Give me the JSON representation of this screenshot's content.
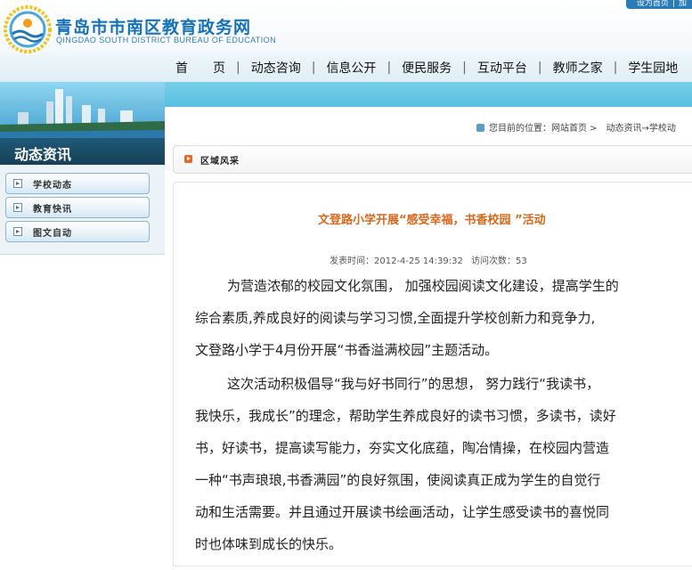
{
  "header": {
    "title": "青岛市市南区教育政务网",
    "subtitle": "QINGDAO SOUTH DISTRICT BUREAU OF EDUCATION",
    "top_links": [
      "设为首页",
      "|",
      "加"
    ]
  },
  "nav": [
    "首　　页",
    "动态咨询",
    "信息公开",
    "便民服务",
    "互动平台",
    "教师之家",
    "学生园地"
  ],
  "sidebar": {
    "title": "动态资讯",
    "items": [
      "学校动态",
      "教育快讯",
      "图文自动"
    ]
  },
  "breadcrumb": "您目前的位置：网站首页 >　动态资讯→学校动",
  "section_label": "区域风采",
  "article": {
    "title": "文登路小学开展“感受幸福，书香校园 ”活动",
    "publish_label": "发表时间：2012-4-25 14:39:32",
    "views_label": "访问次数：53",
    "lines": [
      "为营造浓郁的校园文化氛围， 加强校园阅读文化建设，提高学生的",
      "综合素质,养成良好的阅读与学习习惯,全面提升学校创新力和竞争力,",
      "文登路小学于4月份开展“书香溢满校园”主题活动。",
      "这次活动积极倡导“我与好书同行”的思想， 努力践行“我读书，",
      "我快乐，我成长”的理念，帮助学生养成良好的读书习惯，多读书，读好",
      "书，好读书，提高读写能力，夯实文化底蕴，陶冶情操，在校园内营造",
      "一种“书声琅琅,书香满园”的良好氛围，使阅读真正成为学生的自觉行",
      "动和生活需要。并且通过开展读书绘画活动，让学生感受读书的喜悦同",
      "时也体味到成长的快乐。"
    ]
  }
}
